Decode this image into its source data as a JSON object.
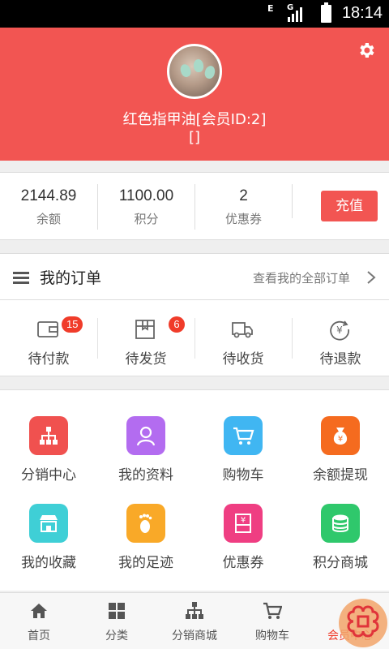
{
  "status_bar": {
    "time": "18:14",
    "network": "G",
    "data_indicator": "E"
  },
  "profile": {
    "name": "红色指甲油[会员ID:2]",
    "subtitle": "[]",
    "settings_icon": "gear-icon"
  },
  "balance": {
    "items": [
      {
        "value": "2144.89",
        "label": "余额"
      },
      {
        "value": "1100.00",
        "label": "积分"
      },
      {
        "value": "2",
        "label": "优惠券"
      }
    ],
    "recharge_label": "充值"
  },
  "orders": {
    "title": "我的订单",
    "view_all": "查看我的全部订单",
    "items": [
      {
        "label": "待付款",
        "badge": "15",
        "icon": "wallet-icon"
      },
      {
        "label": "待发货",
        "badge": "6",
        "icon": "package-icon"
      },
      {
        "label": "待收货",
        "badge": "",
        "icon": "truck-icon"
      },
      {
        "label": "待退款",
        "badge": "",
        "icon": "refund-icon"
      }
    ]
  },
  "grid": {
    "items": [
      {
        "label": "分销中心",
        "icon": "network-icon",
        "color": "#f0514f"
      },
      {
        "label": "我的资料",
        "icon": "user-icon",
        "color": "#b36cf0"
      },
      {
        "label": "购物车",
        "icon": "cart-icon",
        "color": "#40b6f2"
      },
      {
        "label": "余额提现",
        "icon": "money-bag-icon",
        "color": "#f56b1f"
      },
      {
        "label": "我的收藏",
        "icon": "store-icon",
        "color": "#3fcfd6"
      },
      {
        "label": "我的足迹",
        "icon": "footprint-icon",
        "color": "#f9a928"
      },
      {
        "label": "优惠券",
        "icon": "coupon-icon",
        "color": "#ef3e82"
      },
      {
        "label": "积分商城",
        "icon": "coins-icon",
        "color": "#2fc86c"
      }
    ]
  },
  "tabbar": {
    "items": [
      {
        "label": "首页",
        "icon": "home-icon"
      },
      {
        "label": "分类",
        "icon": "grid-icon"
      },
      {
        "label": "分销商城",
        "icon": "network-icon"
      },
      {
        "label": "购物车",
        "icon": "cart-icon"
      },
      {
        "label": "会员中心",
        "icon": "member-icon"
      }
    ],
    "active_index": 4,
    "active_color": "#f03c2a"
  },
  "colors": {
    "brand": "#f25552",
    "badge": "#f03c2a"
  }
}
